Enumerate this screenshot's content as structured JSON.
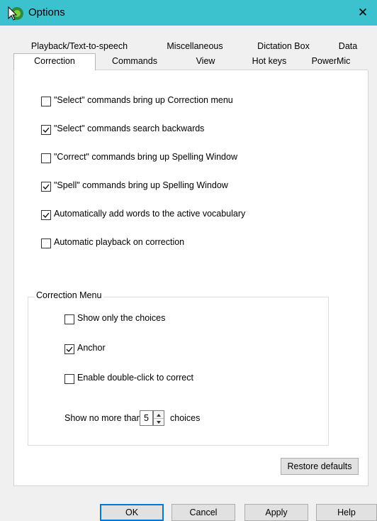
{
  "window": {
    "title": "Options",
    "close_glyph": "✕"
  },
  "tabs": {
    "row1": [
      {
        "label": "Playback/Text-to-speech"
      },
      {
        "label": "Miscellaneous"
      },
      {
        "label": "Dictation Box"
      },
      {
        "label": "Data"
      }
    ],
    "row2": [
      {
        "label": "Correction",
        "active": true
      },
      {
        "label": "Commands"
      },
      {
        "label": "View"
      },
      {
        "label": "Hot keys"
      },
      {
        "label": "PowerMic"
      }
    ]
  },
  "options": [
    {
      "label": "\"Select\" commands bring up Correction menu",
      "checked": false
    },
    {
      "label": "\"Select\" commands search backwards",
      "checked": true
    },
    {
      "label": "\"Correct\" commands bring up Spelling Window",
      "checked": false
    },
    {
      "label": "\"Spell\" commands bring up Spelling Window",
      "checked": true
    },
    {
      "label": "Automatically add words to the active vocabulary",
      "checked": true
    },
    {
      "label": "Automatic playback on correction",
      "checked": false
    }
  ],
  "correction_menu": {
    "title": "Correction Menu",
    "options": [
      {
        "label": "Show only the choices",
        "checked": false
      },
      {
        "label": "Anchor",
        "checked": true
      },
      {
        "label": "Enable double-click to correct",
        "checked": false
      }
    ],
    "show_prefix": "Show no more than",
    "choices_value": "5",
    "show_suffix": "choices"
  },
  "buttons": {
    "restore": "Restore defaults",
    "ok": "OK",
    "cancel": "Cancel",
    "apply": "Apply",
    "help": "Help"
  },
  "colors": {
    "titlebar": "#3cc2ce",
    "accent": "#0078d7"
  },
  "icons": {
    "app": "dragon-icon",
    "close": "close-icon",
    "check": "checkmark-icon"
  }
}
